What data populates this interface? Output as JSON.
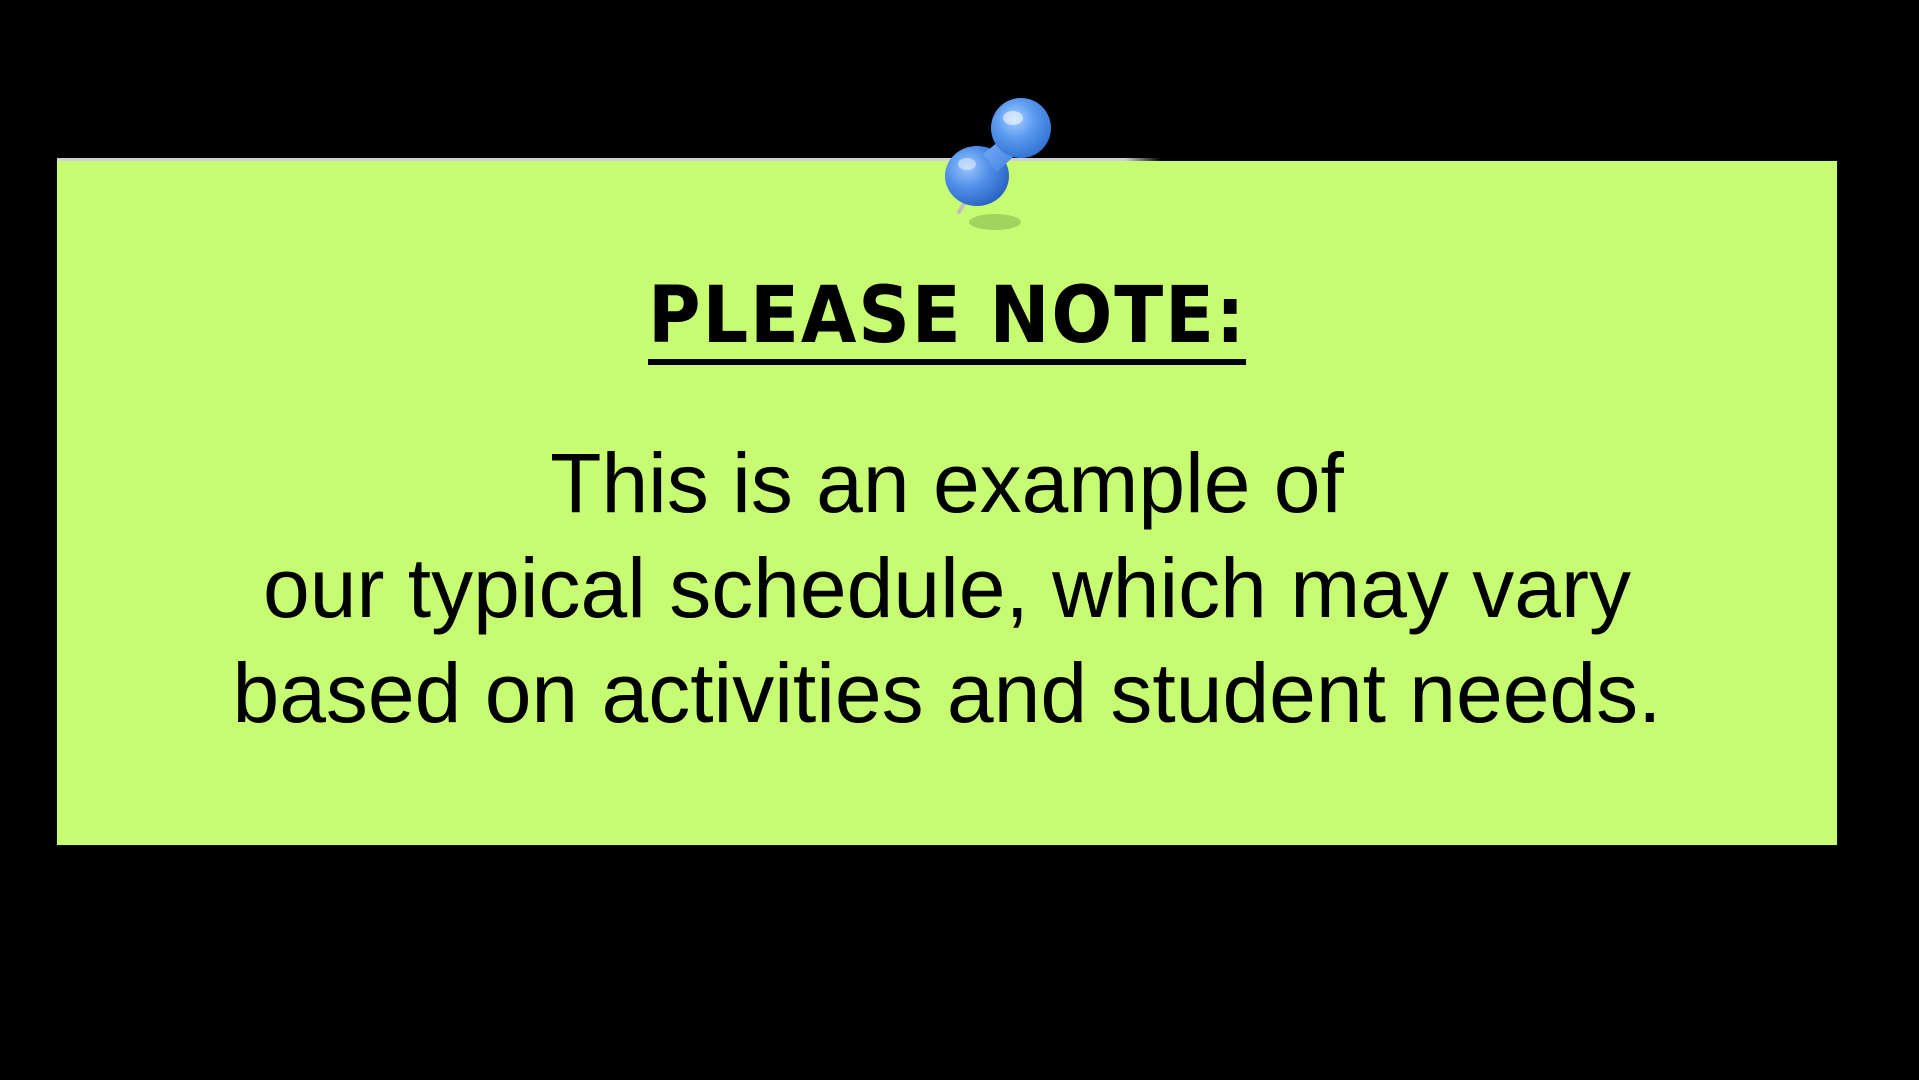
{
  "note": {
    "heading": "PLEASE NOTE:",
    "lines": [
      "This is an example of",
      "our typical schedule, which may vary",
      "based on activities and student needs."
    ]
  },
  "colors": {
    "background": "#000000",
    "note": "#c6fb72",
    "pin": "#5b9cf0",
    "text": "#000000"
  },
  "icons": {
    "pin": "pushpin-icon"
  }
}
